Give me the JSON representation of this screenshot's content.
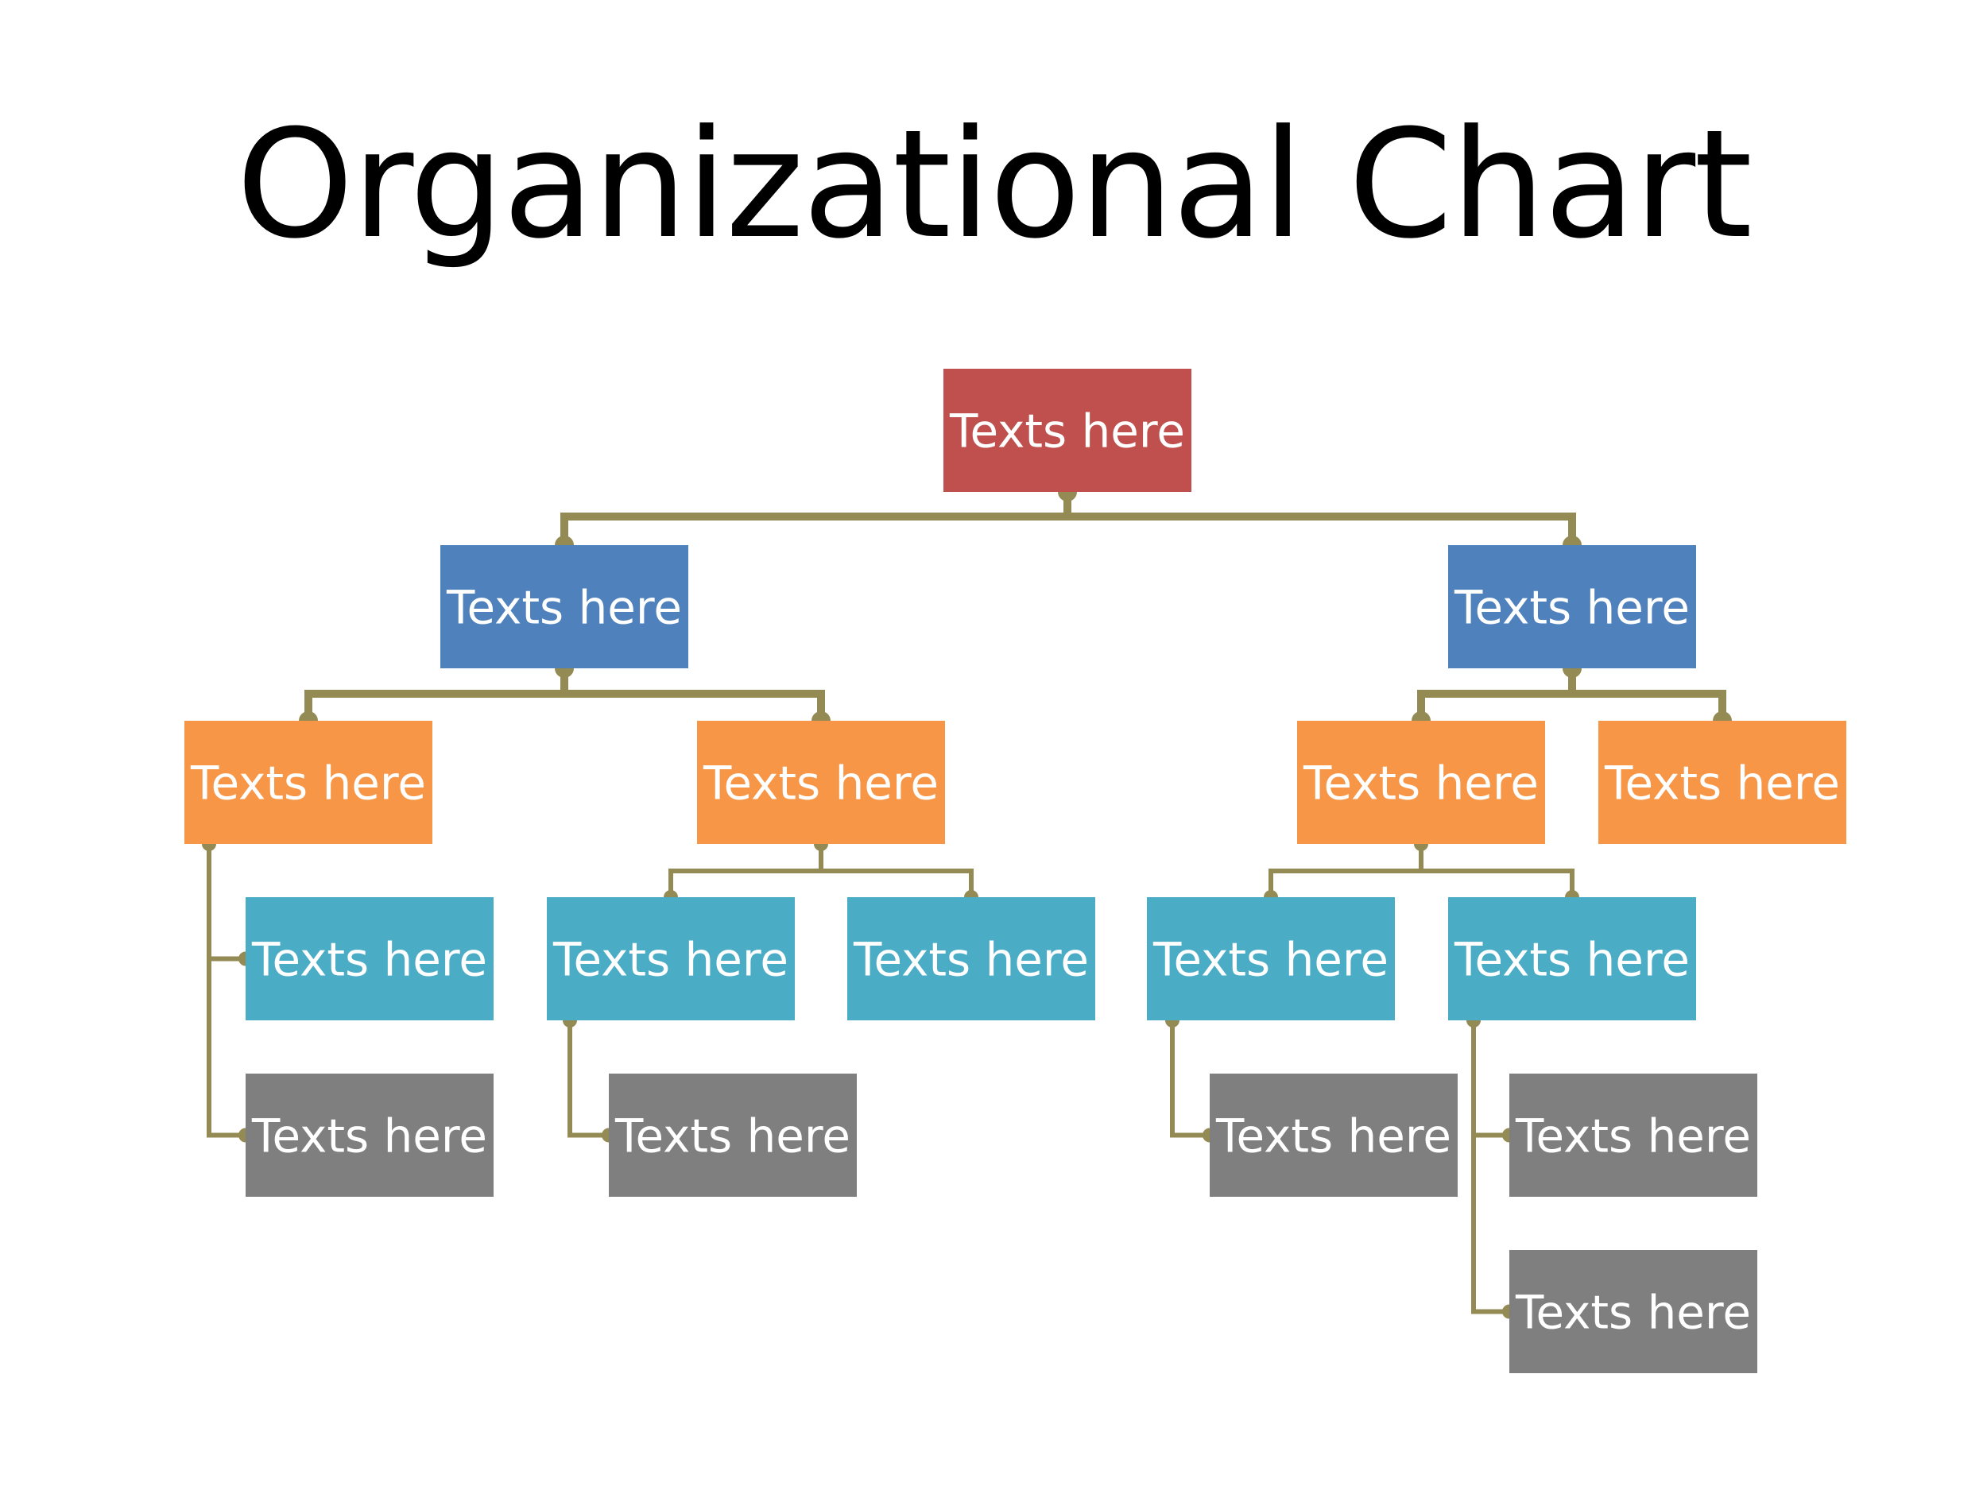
{
  "title": "Organizational Chart",
  "colors": {
    "level1": "#C0504D",
    "level2": "#4F81BD",
    "level3": "#F79646",
    "level4": "#4BACC6",
    "level5": "#7F7F7F",
    "connector": "#948A54",
    "label": "#FFFFFF"
  },
  "nodes": [
    {
      "id": "n1",
      "label": "Texts here",
      "level": 1,
      "parent": null
    },
    {
      "id": "n2",
      "label": "Texts here",
      "level": 2,
      "parent": "n1"
    },
    {
      "id": "n3",
      "label": "Texts here",
      "level": 2,
      "parent": "n1"
    },
    {
      "id": "n4",
      "label": "Texts here",
      "level": 3,
      "parent": "n2"
    },
    {
      "id": "n5",
      "label": "Texts here",
      "level": 3,
      "parent": "n2"
    },
    {
      "id": "n6",
      "label": "Texts here",
      "level": 3,
      "parent": "n3"
    },
    {
      "id": "n7",
      "label": "Texts here",
      "level": 3,
      "parent": "n3"
    },
    {
      "id": "n8",
      "label": "Texts here",
      "level": 4,
      "parent": "n4"
    },
    {
      "id": "n9",
      "label": "Texts here",
      "level": 5,
      "parent": "n4"
    },
    {
      "id": "n10",
      "label": "Texts here",
      "level": 4,
      "parent": "n5"
    },
    {
      "id": "n11",
      "label": "Texts here",
      "level": 4,
      "parent": "n5"
    },
    {
      "id": "n12",
      "label": "Texts here",
      "level": 5,
      "parent": "n10"
    },
    {
      "id": "n13",
      "label": "Texts here",
      "level": 4,
      "parent": "n6"
    },
    {
      "id": "n14",
      "label": "Texts here",
      "level": 4,
      "parent": "n6"
    },
    {
      "id": "n15",
      "label": "Texts here",
      "level": 5,
      "parent": "n13"
    },
    {
      "id": "n16",
      "label": "Texts here",
      "level": 5,
      "parent": "n14"
    },
    {
      "id": "n17",
      "label": "Texts here",
      "level": 5,
      "parent": "n14"
    }
  ]
}
